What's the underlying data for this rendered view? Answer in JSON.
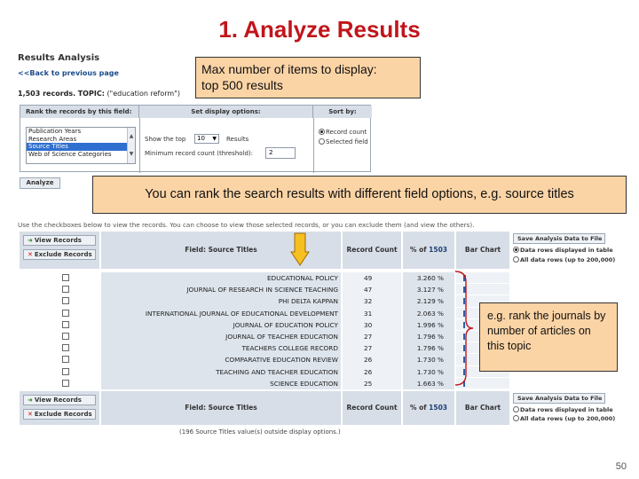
{
  "slide": {
    "title": "1. Analyze Results",
    "page_number": "50"
  },
  "analysis": {
    "heading": "Results Analysis",
    "back_link": "<<Back to previous page",
    "records_count": "1,503 records.",
    "topic_label": "TOPIC:",
    "topic_value": "(\"education reform\")",
    "rank_header": "Rank the records by this field:",
    "display_header": "Set display options:",
    "sort_header": "Sort by:",
    "rank_fields": [
      {
        "label": "Publication Years",
        "selected": false
      },
      {
        "label": "Research Areas",
        "selected": false
      },
      {
        "label": "Source Titles",
        "selected": true
      },
      {
        "label": "Web of Science Categories",
        "selected": false
      }
    ],
    "show_top_label": "Show the top",
    "show_top_value": "10",
    "results_label": "Results",
    "min_count_label": "Minimum record count (threshold):",
    "min_count_value": "2",
    "sort_options": [
      {
        "label": "Record count",
        "selected": true
      },
      {
        "label": "Selected field",
        "selected": false
      }
    ],
    "analyze_button": "Analyze"
  },
  "records": {
    "instructions": "Use the checkboxes below to view the records. You can choose to view those selected records, or you can exclude them (and view the others).",
    "view_button": "View Records",
    "exclude_button": "Exclude Records",
    "columns": {
      "field": "Field: Source Titles",
      "count": "Record Count",
      "pct_prefix": "% of",
      "pct_total": "1503",
      "bar": "Bar Chart"
    },
    "save_button": "Save Analysis Data to File",
    "save_options": [
      {
        "label": "Data rows displayed in table",
        "selected": true
      },
      {
        "label": "All data rows (up to 200,000)",
        "selected": false
      }
    ],
    "rows": [
      {
        "title": "EDUCATIONAL POLICY",
        "count": "49",
        "pct": "3.260 %",
        "fraction": 0.0326
      },
      {
        "title": "JOURNAL OF RESEARCH IN SCIENCE TEACHING",
        "count": "47",
        "pct": "3.127 %",
        "fraction": 0.03127
      },
      {
        "title": "PHI DELTA KAPPAN",
        "count": "32",
        "pct": "2.129 %",
        "fraction": 0.02129
      },
      {
        "title": "INTERNATIONAL JOURNAL OF EDUCATIONAL DEVELOPMENT",
        "count": "31",
        "pct": "2.063 %",
        "fraction": 0.02063
      },
      {
        "title": "JOURNAL OF EDUCATION POLICY",
        "count": "30",
        "pct": "1.996 %",
        "fraction": 0.01996
      },
      {
        "title": "JOURNAL OF TEACHER EDUCATION",
        "count": "27",
        "pct": "1.796 %",
        "fraction": 0.01796
      },
      {
        "title": "TEACHERS COLLEGE RECORD",
        "count": "27",
        "pct": "1.796 %",
        "fraction": 0.01796
      },
      {
        "title": "COMPARATIVE EDUCATION REVIEW",
        "count": "26",
        "pct": "1.730 %",
        "fraction": 0.0173
      },
      {
        "title": "TEACHING AND TEACHER EDUCATION",
        "count": "26",
        "pct": "1.730 %",
        "fraction": 0.0173
      },
      {
        "title": "SCIENCE EDUCATION",
        "count": "25",
        "pct": "1.663 %",
        "fraction": 0.01663
      }
    ],
    "outside_note": "(196 Source Titles value(s) outside display options.)"
  },
  "callouts": {
    "max_items_line1": "Max number of items to display:",
    "max_items_line2": "top 500 results",
    "rank": "You can rank the search results with different field options, e.g. source titles",
    "journals": "e.g. rank the journals by number of articles on this topic"
  },
  "colors": {
    "title_red": "#c0161c",
    "callout_fill": "#fbd4a6",
    "arrow_fill": "#f5c020",
    "bar_blue": "#2f5ca8"
  }
}
